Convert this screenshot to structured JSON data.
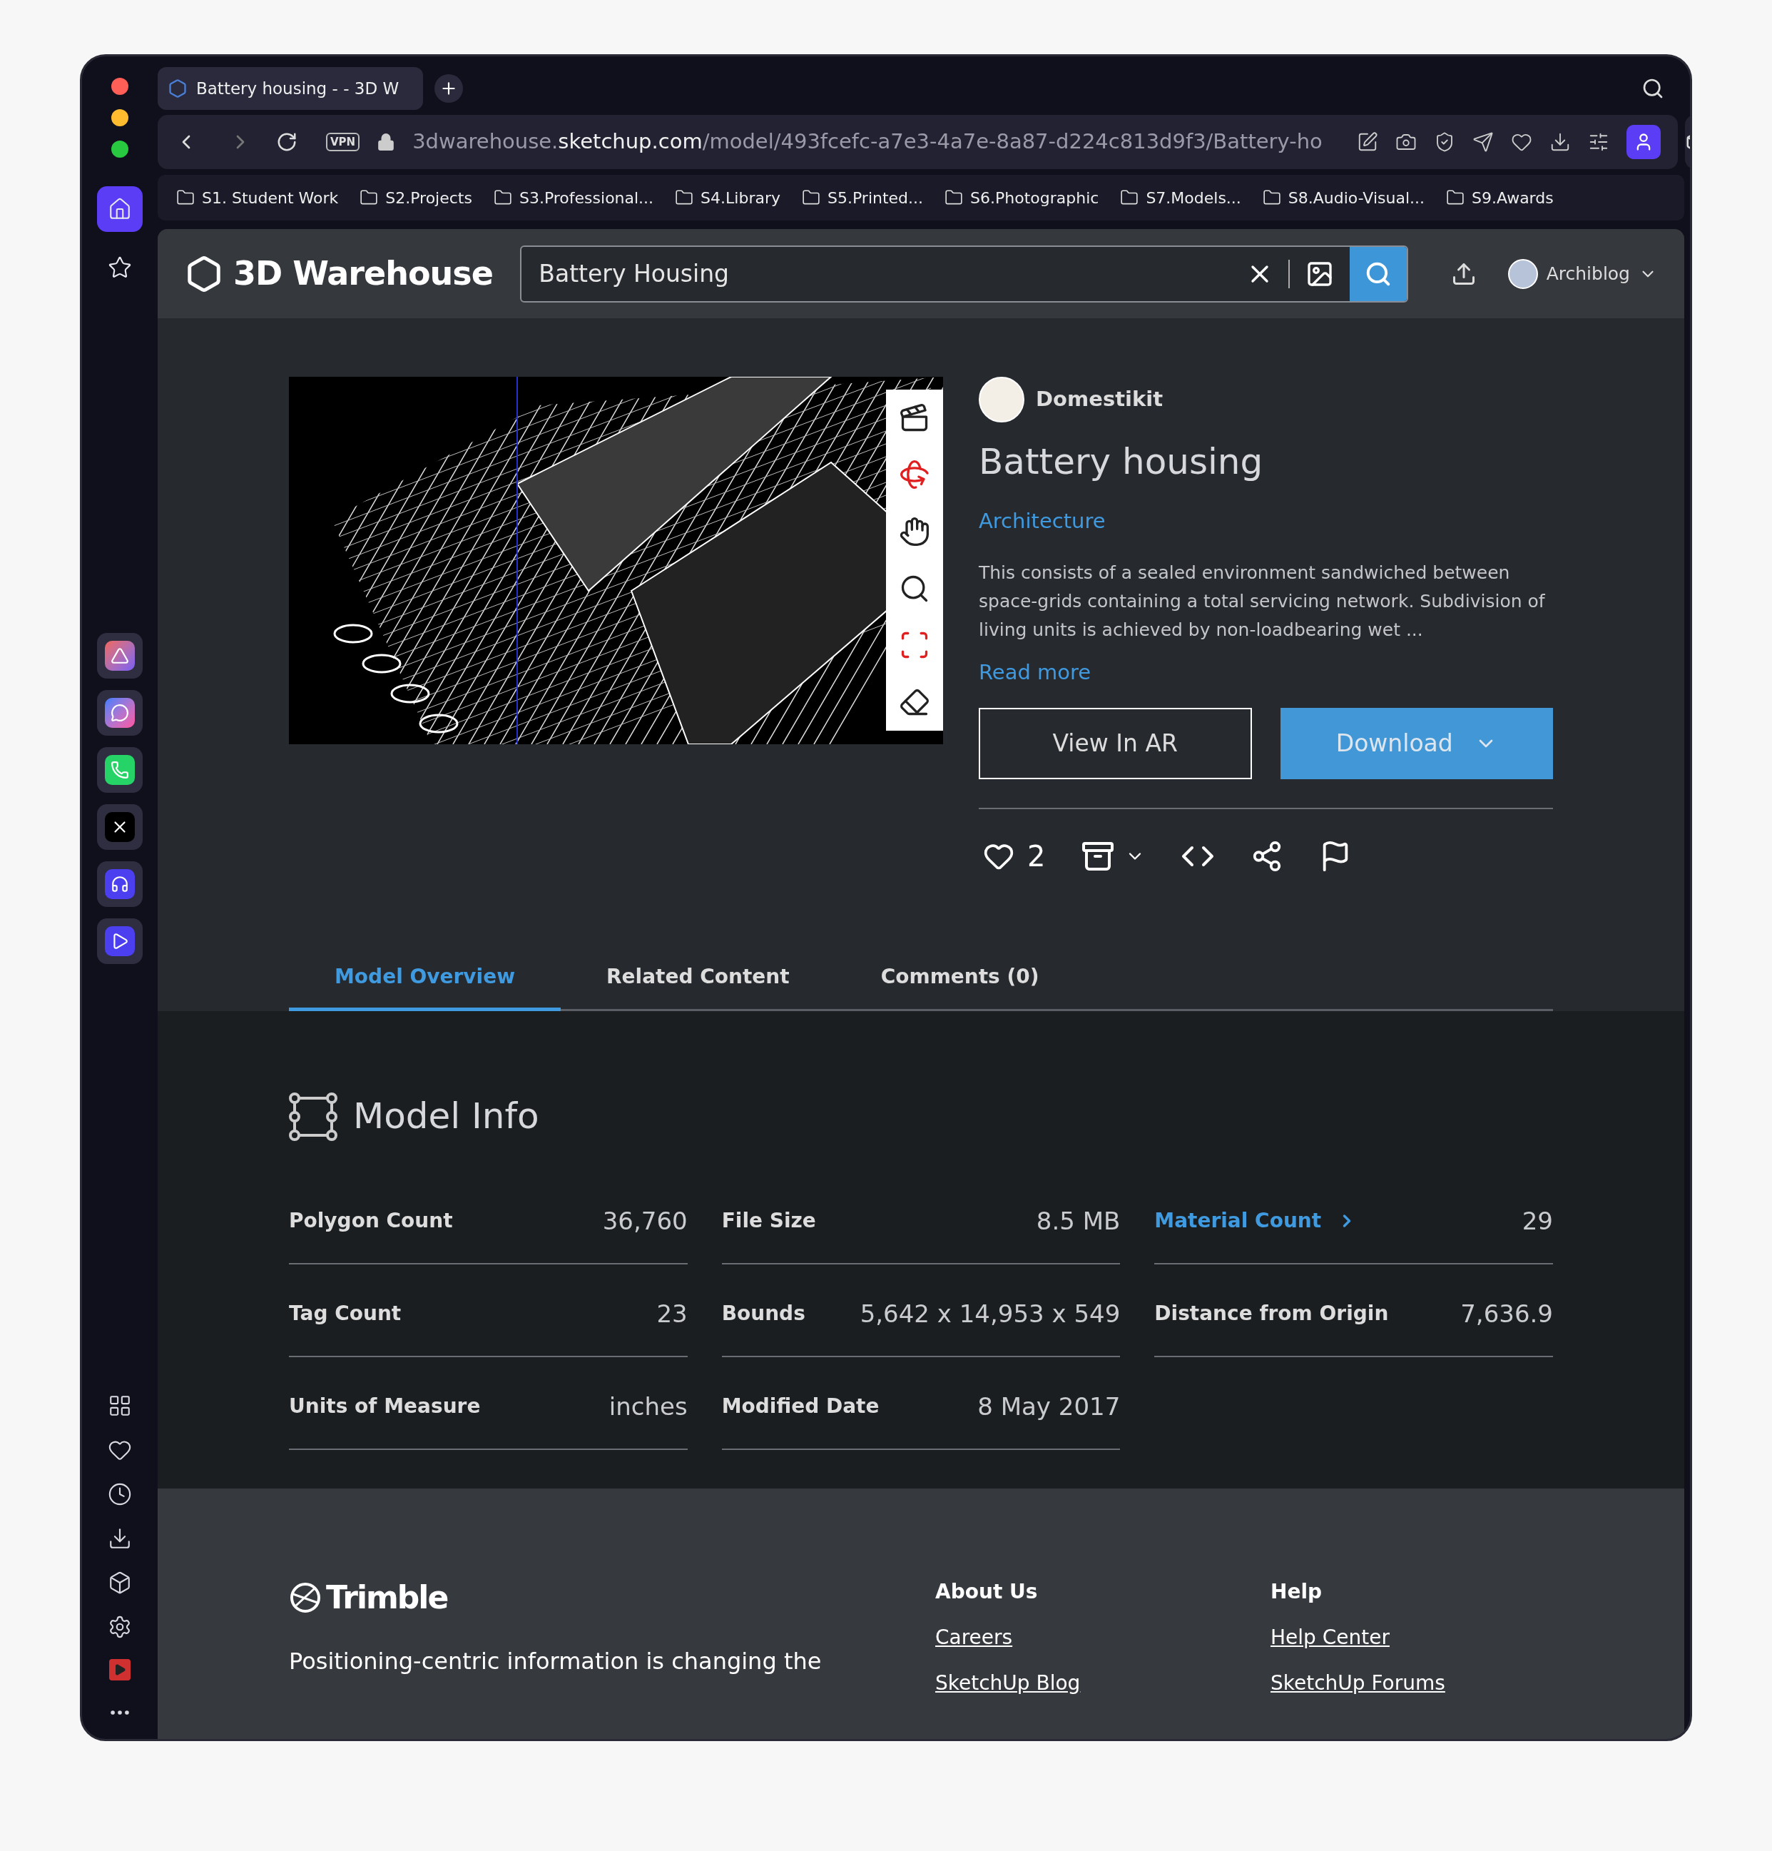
{
  "browser": {
    "tab": {
      "title": "Battery housing - - 3D W"
    },
    "address": {
      "vpn": "VPN",
      "prefix": "3dwarehouse.",
      "host": "sketchup.com",
      "path": "/model/493fcefc-a7e3-4a7e-8a87-d224c813d9f3/Battery-ho"
    },
    "bookmarks": [
      "S1. Student Work",
      "S2.Projects",
      "S3.Professional...",
      "S4.Library",
      "S5.Printed...",
      "S6.Photographic",
      "S7.Models...",
      "S8.Audio-Visual...",
      "S9.Awards"
    ],
    "sidebar": [
      {
        "selected": true
      },
      {
        "selected": false
      }
    ]
  },
  "site": {
    "logo": "3D Warehouse",
    "search": {
      "value": "Battery Housing"
    },
    "user": "Archiblog"
  },
  "model": {
    "author": "Domestikit",
    "title": "Battery housing",
    "category": "Architecture",
    "description": "This consists of a sealed environment sandwiched between space-grids containing a total servicing network. Subdivision of living units is achieved by non-loadbearing wet ...",
    "read_more": "Read more",
    "view_ar": "View In AR",
    "download": "Download",
    "likes": "2"
  },
  "tabs": [
    {
      "label": "Model Overview",
      "selected": true
    },
    {
      "label": "Related Content",
      "selected": false
    },
    {
      "label": "Comments (0)",
      "selected": false
    }
  ],
  "model_info": {
    "title": "Model Info",
    "items": [
      {
        "label": "Polygon Count",
        "value": "36,760",
        "kind": "plain"
      },
      {
        "label": "File Size",
        "value": "8.5 MB",
        "kind": "plain"
      },
      {
        "label": "Material Count",
        "value": "29",
        "kind": "link"
      },
      {
        "label": "Tag Count",
        "value": "23",
        "kind": "plain"
      },
      {
        "label": "Bounds",
        "value": "5,642 x 14,953 x 549",
        "kind": "plain"
      },
      {
        "label": "Distance from Origin",
        "value": "7,636.9",
        "kind": "plain"
      },
      {
        "label": "Units of Measure",
        "value": "inches",
        "kind": "plain"
      },
      {
        "label": "Modified Date",
        "value": "8 May 2017",
        "kind": "plain"
      }
    ]
  },
  "footer": {
    "brand": "Trimble",
    "tagline": "Positioning-centric information is changing the",
    "columns": [
      {
        "title": "About Us",
        "links": [
          "Careers",
          "SketchUp Blog"
        ]
      },
      {
        "title": "Help",
        "links": [
          "Help Center",
          "SketchUp Forums"
        ]
      }
    ]
  }
}
